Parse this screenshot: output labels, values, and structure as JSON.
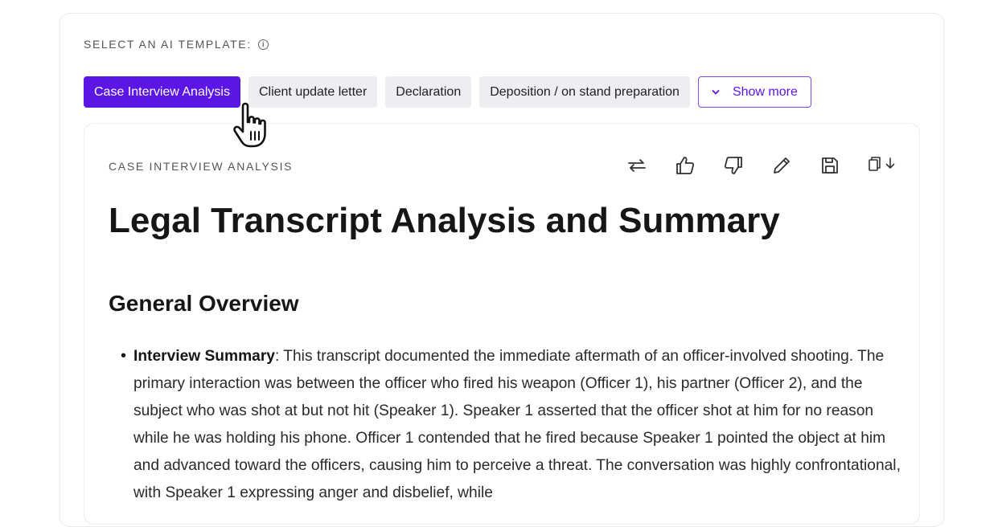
{
  "template_selector": {
    "label": "SELECT AN AI TEMPLATE:",
    "info_icon": "info-icon",
    "options": [
      {
        "label": "Case Interview Analysis",
        "active": true
      },
      {
        "label": "Client update letter",
        "active": false
      },
      {
        "label": "Declaration",
        "active": false
      },
      {
        "label": "Deposition / on stand preparation",
        "active": false
      }
    ],
    "show_more_label": "Show more",
    "accent_color": "#5b16e6"
  },
  "result": {
    "section_label": "CASE INTERVIEW ANALYSIS",
    "toolbar": [
      "swap-icon",
      "thumbs-up-icon",
      "thumbs-down-icon",
      "pencil-icon",
      "save-icon",
      "copy-download-icon"
    ],
    "title": "Legal Transcript Analysis and Summary",
    "heading": "General Overview",
    "bullet_term": "Interview Summary",
    "bullet_text": ": This transcript documented the immediate aftermath of an officer-involved shooting. The primary interaction was between the officer who fired his weapon (Officer 1), his partner (Officer 2), and the subject who was shot at but not hit (Speaker 1). Speaker 1 asserted that the officer shot at him for no reason while he was holding his phone. Officer 1 contended that he fired because Speaker 1 pointed the object at him and advanced toward the officers, causing him to perceive a threat. The conversation was highly confrontational, with Speaker 1 expressing anger and disbelief, while"
  }
}
